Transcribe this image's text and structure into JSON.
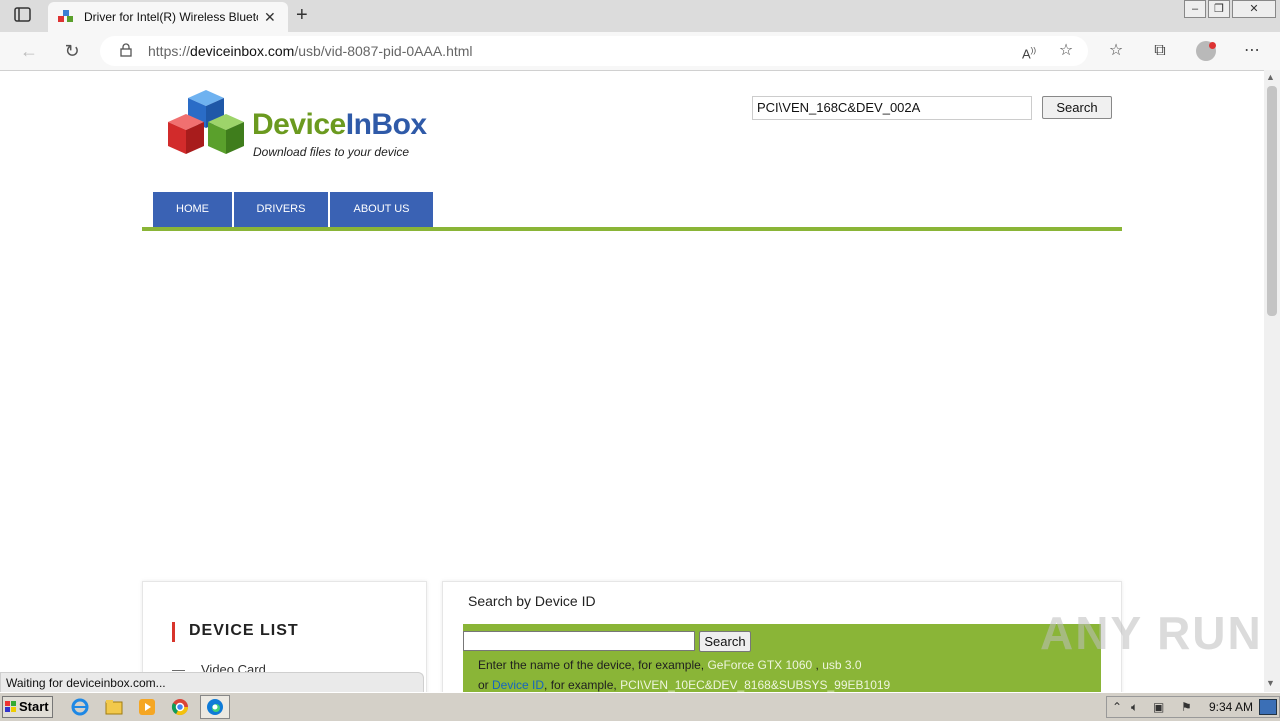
{
  "browser": {
    "tab_title": "Driver for Intel(R) Wireless Blueto",
    "url_prefix": "https://",
    "url_domain": "deviceinbox.com",
    "url_path": "/usb/vid-8087-pid-0AAA.html",
    "status_text": "Waiting for deviceinbox.com..."
  },
  "site": {
    "brand_part1": "Device",
    "brand_part2": "In",
    "brand_part3": "Box",
    "tagline": "Download files to your device",
    "top_search_value": "PCI\\VEN_168C&DEV_002A",
    "top_search_button": "Search",
    "nav": [
      "HOME",
      "DRIVERS",
      "ABOUT US"
    ]
  },
  "device_list": {
    "title": "DEVICE LIST",
    "items": [
      "Video Card"
    ]
  },
  "search_device": {
    "title": "Search by Device ID",
    "button": "Search",
    "help_line1_prefix": "Enter the name of the device, for example, ",
    "help_example1": "GeForce GTX 1060",
    "help_sep": " , ",
    "help_example2": "usb 3.0",
    "help_line2_prefix": "or ",
    "help_link": "Device ID",
    "help_line2_mid": ", for example, ",
    "help_example3": "PCI\\VEN_10EC&DEV_8168&SUBSYS_99EB1019"
  },
  "watermark": "ANY RUN",
  "taskbar": {
    "start_label": "Start",
    "clock": "9:34 AM"
  },
  "colors": {
    "nav_blue": "#3a62b4",
    "accent_green": "#8ab537",
    "brand_green": "#6b9a1f",
    "brand_blue": "#2f5aa8"
  }
}
